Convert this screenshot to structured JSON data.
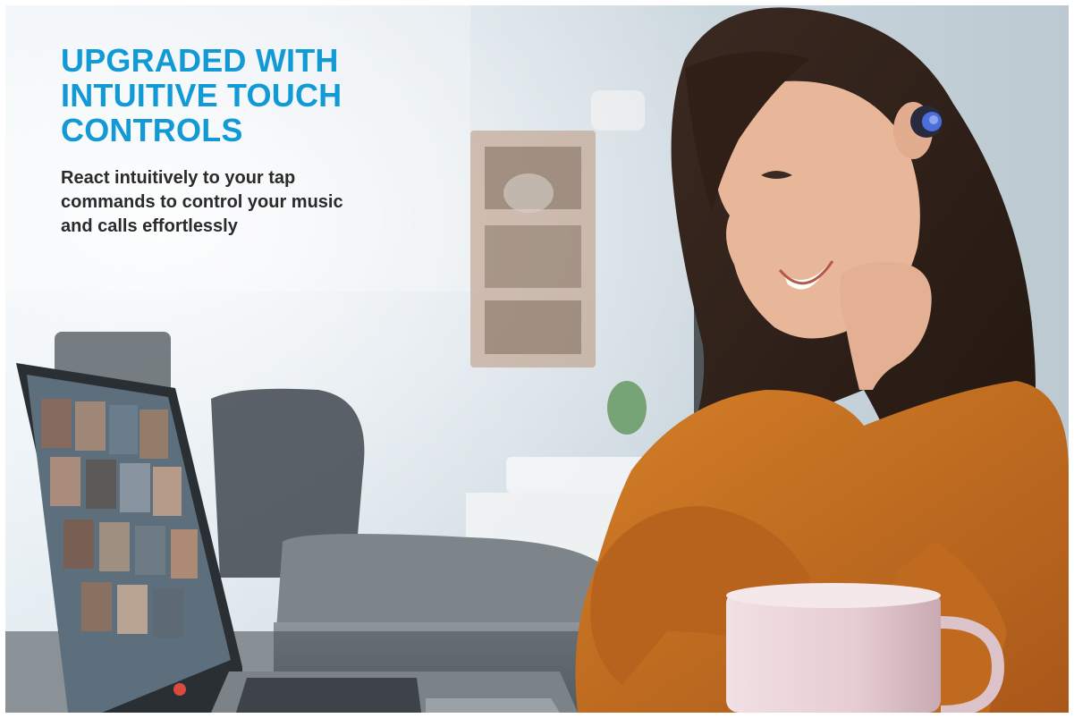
{
  "banner": {
    "headline_lines": [
      "UPGRADED WITH",
      "INTUITIVE TOUCH",
      "CONTROLS"
    ],
    "subtext_lines": [
      "React intuitively to your tap",
      "commands to control your music",
      "and calls effortlessly"
    ],
    "colors": {
      "headline": "#119ad6",
      "body_text": "#2a2a2a",
      "sweater": "#c9711f",
      "earbud_accent": "#4a6fd8"
    },
    "icons": {
      "photo": "woman-with-earbuds-video-call-photo"
    }
  }
}
